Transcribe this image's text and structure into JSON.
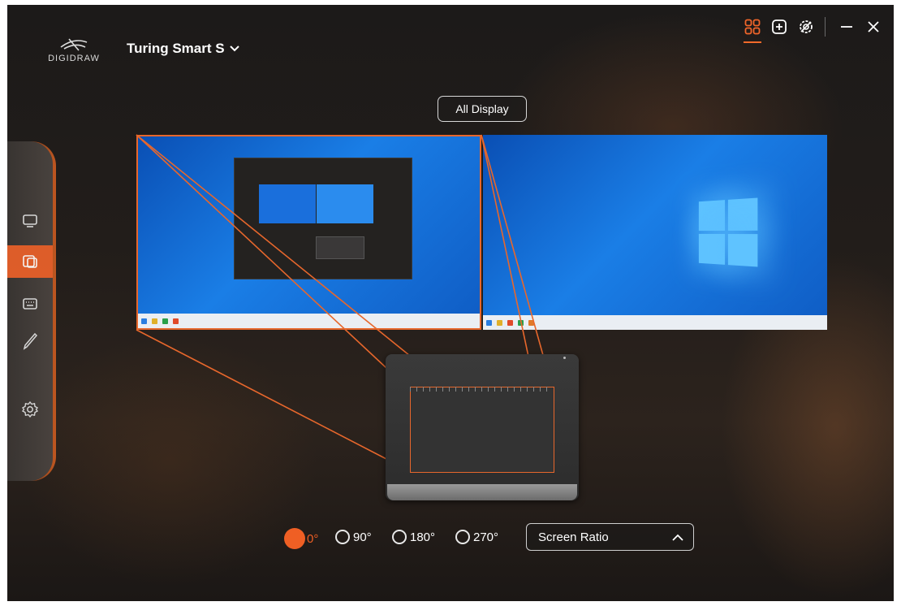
{
  "app": {
    "logo_text": "DIGIDRAW",
    "device_name": "Turing Smart S"
  },
  "toolbar": {
    "icons": [
      "grid-layout-icon",
      "add-box-icon",
      "settings-badge-icon"
    ],
    "window": [
      "minimize-icon",
      "close-icon"
    ]
  },
  "display": {
    "all_display_label": "All Display"
  },
  "sidebar": {
    "items": [
      {
        "name": "monitor-icon",
        "active": false
      },
      {
        "name": "screen-mapping-icon",
        "active": true
      },
      {
        "name": "keyboard-icon",
        "active": false
      },
      {
        "name": "pen-icon",
        "active": false
      },
      {
        "name": "gear-icon",
        "active": false
      }
    ]
  },
  "rotation": {
    "options": [
      "0°",
      "90°",
      "180°",
      "270°"
    ],
    "selected": "0°"
  },
  "ratio_select": {
    "value": "Screen Ratio"
  },
  "colors": {
    "accent": "#ef5f24",
    "sidebar_active": "#e8612a"
  }
}
